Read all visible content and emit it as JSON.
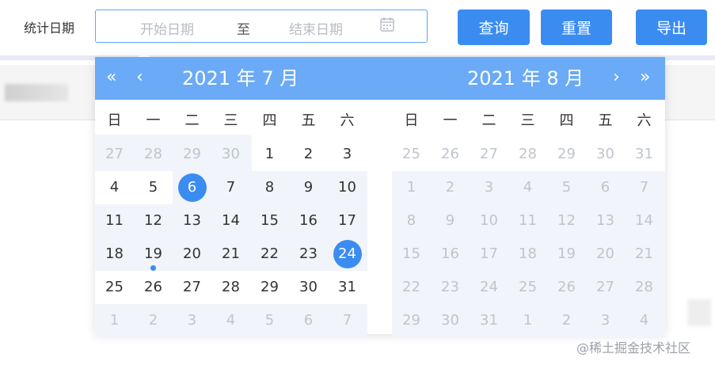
{
  "filter": {
    "label": "统计日期",
    "start_placeholder": "开始日期",
    "separator": "至",
    "end_placeholder": "结束日期"
  },
  "buttons": {
    "query": "查询",
    "reset": "重置",
    "export": "导出"
  },
  "picker": {
    "left_title": "2021 年 7 月",
    "right_title": "2021 年 8 月",
    "nav": {
      "prev_year": "«",
      "prev_month": "‹",
      "next_month": "›",
      "next_year": "»"
    },
    "weekdays": [
      "日",
      "一",
      "二",
      "三",
      "四",
      "五",
      "六"
    ],
    "left_days": [
      [
        "27",
        "28",
        "29",
        "30",
        "1",
        "2",
        "3"
      ],
      [
        "4",
        "5",
        "6",
        "7",
        "8",
        "9",
        "10"
      ],
      [
        "11",
        "12",
        "13",
        "14",
        "15",
        "16",
        "17"
      ],
      [
        "18",
        "19",
        "20",
        "21",
        "22",
        "23",
        "24"
      ],
      [
        "25",
        "26",
        "27",
        "28",
        "29",
        "30",
        "31"
      ],
      [
        "1",
        "2",
        "3",
        "4",
        "5",
        "6",
        "7"
      ]
    ],
    "right_days": [
      [
        "25",
        "26",
        "27",
        "28",
        "29",
        "30",
        "31"
      ],
      [
        "1",
        "2",
        "3",
        "4",
        "5",
        "6",
        "7"
      ],
      [
        "8",
        "9",
        "10",
        "11",
        "12",
        "13",
        "14"
      ],
      [
        "15",
        "16",
        "17",
        "18",
        "19",
        "20",
        "21"
      ],
      [
        "22",
        "23",
        "24",
        "25",
        "26",
        "27",
        "28"
      ],
      [
        "29",
        "30",
        "31",
        "1",
        "2",
        "3",
        "4"
      ]
    ],
    "selected_start": "6",
    "selected_end": "24",
    "today": "19"
  },
  "watermark": "@稀土掘金技术社区",
  "colors": {
    "accent": "#3b8cf0",
    "header": "#6aaaf6"
  }
}
